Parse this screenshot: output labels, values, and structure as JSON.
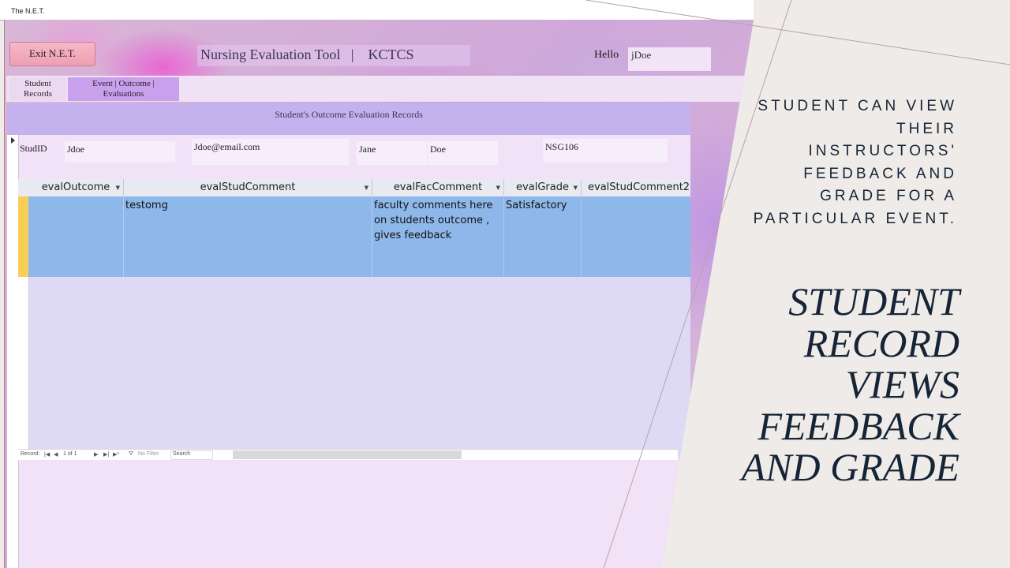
{
  "window": {
    "title": "The N.E.T."
  },
  "header": {
    "exit_label": "Exit N.E.T.",
    "app_title": "Nursing Evaluation Tool   |    KCTCS",
    "hello_label": "Hello",
    "hello_user": "jDoe"
  },
  "tabs": [
    {
      "label": "Student\nRecords"
    },
    {
      "label": "Event | Outcome |\nEvaluations"
    }
  ],
  "form": {
    "heading": "Student's Outcome Evaluation Records",
    "stud_id_label": "StudID",
    "stud_id": "Jdoe",
    "email": "Jdoe@email.com",
    "first_name": "Jane",
    "last_name": "Doe",
    "course": "NSG106"
  },
  "grid": {
    "columns": [
      "evalOutcome",
      "evalStudComment",
      "evalFacComment",
      "evalGrade",
      "evalStudComment2"
    ],
    "rows": [
      [
        "",
        "testomg",
        "faculty comments here on students outcome , gives feedback",
        "Satisfactory",
        ""
      ]
    ]
  },
  "navigation": {
    "record_label": "Record:",
    "record_position": "1 of 1",
    "filter_label": "No Filter",
    "search_label": "Search"
  },
  "slide": {
    "callout": "STUDENT CAN VIEW\nTHEIR INSTRUCTORS'\nFEEDBACK AND\nGRADE FOR A\nPARTICULAR EVENT.",
    "title": "STUDENT\nRECORD\nVIEWS\nFEEDBACK\nAND GRADE"
  },
  "colors": {
    "slide_background": "#efebe8",
    "slide_text": "#152436",
    "form_header": "#c3b2ee",
    "selected_row": "#8fb8ea",
    "record_selector": "#f8ce57",
    "exit_button": "#ee9fb2"
  }
}
